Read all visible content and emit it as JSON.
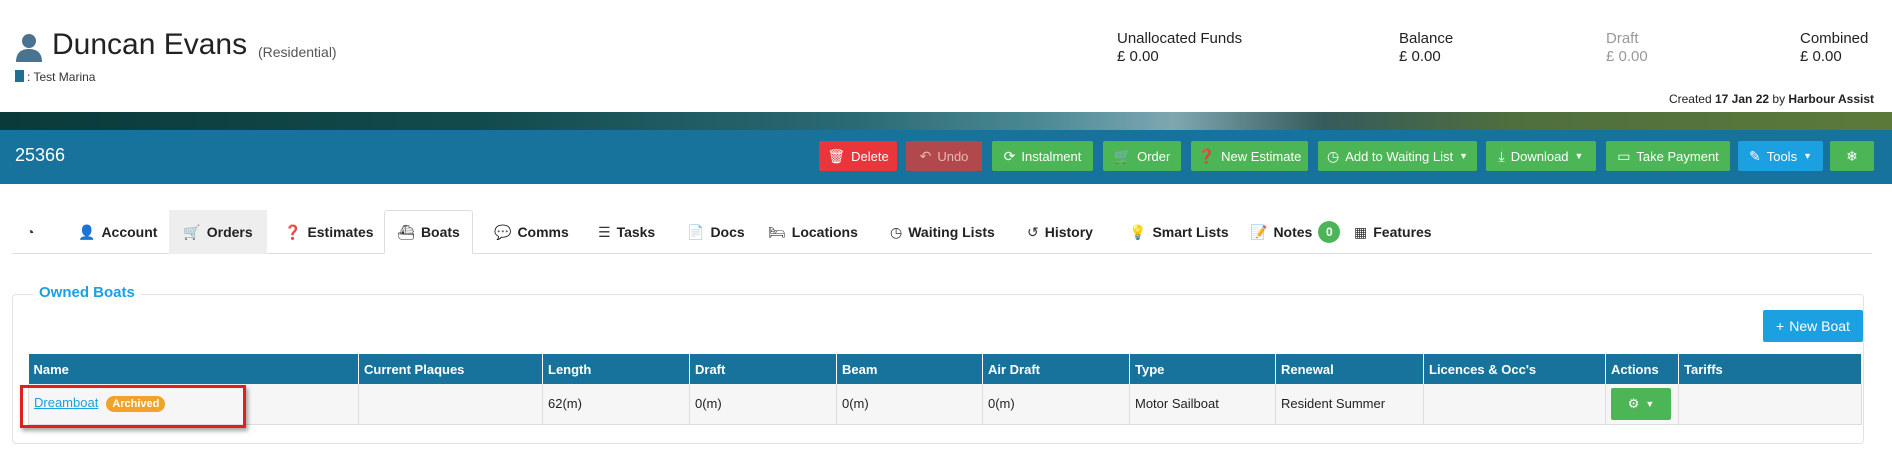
{
  "header": {
    "name": "Duncan Evans",
    "type": "(Residential)",
    "marina": ": Test Marina",
    "funds": [
      {
        "label": "Unallocated Funds",
        "value": "£ 0.00"
      },
      {
        "label": "Balance",
        "value": "£ 0.00"
      },
      {
        "label": "Draft",
        "value": "£ 0.00"
      },
      {
        "label": "Combined",
        "value": "£ 0.00"
      }
    ],
    "created_prefix": "Created",
    "created_date": "17 Jan 22",
    "created_by_prefix": "by",
    "created_by": "Harbour Assist"
  },
  "toolbar": {
    "record_id": "25366",
    "delete": "Delete",
    "undo": "Undo",
    "instalment": "Instalment",
    "order": "Order",
    "new_estimate": "New Estimate",
    "waiting_list": "Add to Waiting List",
    "download": "Download",
    "take_payment": "Take Payment",
    "tools": "Tools"
  },
  "tabs": [
    {
      "label": "",
      "icon": "dashboard-icon"
    },
    {
      "label": "Account",
      "icon": "user-icon"
    },
    {
      "label": "Orders",
      "icon": "cart-icon"
    },
    {
      "label": "Estimates",
      "icon": "question-icon"
    },
    {
      "label": "Boats",
      "icon": "boat-icon"
    },
    {
      "label": "Comms",
      "icon": "comments-icon"
    },
    {
      "label": "Tasks",
      "icon": "tasks-icon"
    },
    {
      "label": "Docs",
      "icon": "document-icon"
    },
    {
      "label": "Locations",
      "icon": "bed-icon"
    },
    {
      "label": "Waiting Lists",
      "icon": "clock-icon"
    },
    {
      "label": "History",
      "icon": "history-icon"
    },
    {
      "label": "Smart Lists",
      "icon": "lightbulb-icon"
    },
    {
      "label": "Notes",
      "icon": "note-icon",
      "badge": "0"
    },
    {
      "label": "Features",
      "icon": "grid-icon"
    }
  ],
  "boats_panel": {
    "title": "Owned Boats",
    "new_boat": "New Boat",
    "columns": [
      "Name",
      "Current Plaques",
      "Length",
      "Draft",
      "Beam",
      "Air Draft",
      "Type",
      "Renewal",
      "Licences & Occ's",
      "Actions",
      "Tariffs"
    ],
    "rows": [
      {
        "name": "Dreamboat",
        "status": "Archived",
        "plaques": "",
        "length": "62(m)",
        "draft": "0(m)",
        "beam": "0(m)",
        "air_draft": "0(m)",
        "type": "Motor Sailboat",
        "renewal": "Resident Summer",
        "licences": "",
        "tariffs": ""
      }
    ]
  },
  "colors": {
    "primary": "#17739b",
    "accent": "#1ba0e2",
    "success": "#4cb657",
    "danger": "#e8363b",
    "warning": "#f0a22b"
  }
}
